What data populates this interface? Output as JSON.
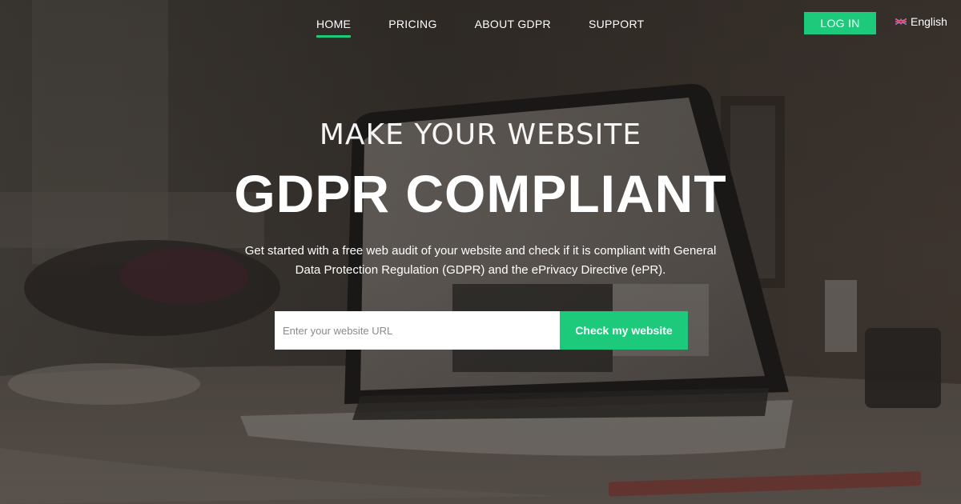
{
  "nav": {
    "links": [
      {
        "label": "HOME",
        "active": true
      },
      {
        "label": "PRICING"
      },
      {
        "label": "ABOUT GDPR"
      },
      {
        "label": "SUPPORT"
      }
    ],
    "login_label": "LOG IN",
    "language": {
      "label": "English",
      "flag_icon": "uk-flag-icon"
    }
  },
  "hero": {
    "subtitle": "MAKE YOUR WEBSITE",
    "title": "GDPR COMPLIANT",
    "description": "Get started with a free web audit of your website and check if it is compliant with General Data Protection Regulation (GDPR) and the ePrivacy Directive (ePR)."
  },
  "form": {
    "url_placeholder": "Enter your website URL",
    "url_value": "",
    "submit_label": "Check my website"
  },
  "colors": {
    "accent": "#1dc97a",
    "text": "#ffffff"
  }
}
